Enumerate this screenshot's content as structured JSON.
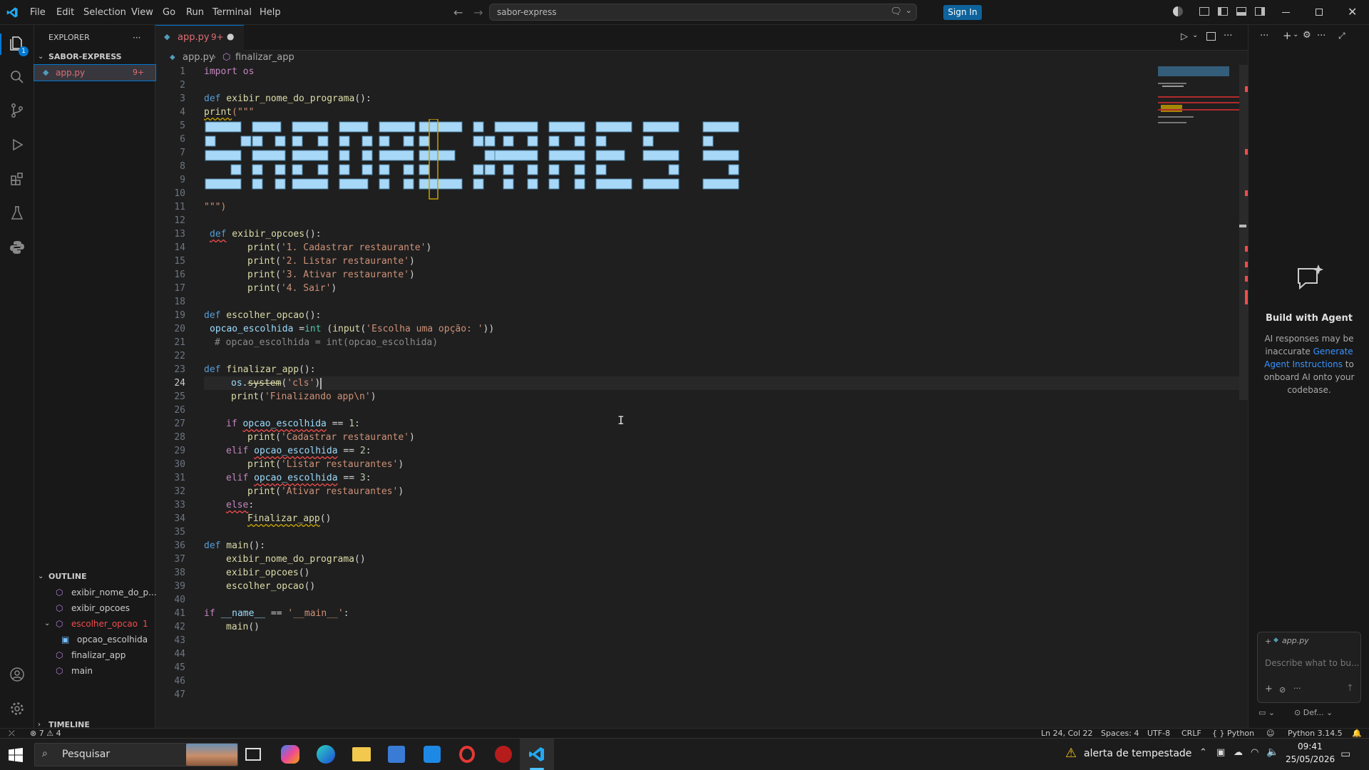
{
  "titlebar": {
    "menus": [
      "File",
      "Edit",
      "Selection",
      "View",
      "Go",
      "Run",
      "Terminal",
      "Help"
    ],
    "search_text": "sabor-express",
    "signin_label": "Sign In"
  },
  "sidebar": {
    "explorer_title": "EXPLORER",
    "project_name": "SABOR-EXPRESS",
    "file_name": "app.py",
    "file_badge": "9+",
    "outline_title": "OUTLINE",
    "outline_items": [
      "exibir_nome_do_p...",
      "exibir_opcoes",
      "escolher_opcao",
      "opcao_escolhida",
      "finalizar_app",
      "main"
    ],
    "outline_error_count": "1",
    "timeline_title": "TIMELINE"
  },
  "activity": {
    "explorer_badge": "1"
  },
  "editor": {
    "tab_label": "app.py",
    "tab_badge": "9+",
    "breadcrumb_file": "app.py",
    "breadcrumb_symbol": "finalizar_app",
    "lines": {
      "l1": "import os",
      "l3a": "def",
      "l3b": " exibir_nome_do_programa",
      "l3c": "():",
      "l4a": "print",
      "l4b": "(\"\"\"",
      "l11": "\"\"\")",
      "l13a": "def",
      "l13b": " exibir_opcoes",
      "l13c": "():",
      "l14": "'1. Cadastrar restaurante'",
      "l15": "'2. Listar restaurante'",
      "l16": "'3. Ativar restaurante'",
      "l17": "'4. Sair'",
      "l19a": "def",
      "l19b": " escolher_opcao",
      "l19c": "():",
      "l20a": "opcao_escolhida",
      "l20b": " =",
      "l20c": "int",
      "l20d": " (",
      "l20e": "input",
      "l20f": "(",
      "l20g": "'Escolha uma opção: '",
      "l20h": "))",
      "l21": "# opcao_escolhida = int(opcao_escolhida)",
      "l23a": "def",
      "l23b": " finalizar_app",
      "l23c": "():",
      "l24a": "os",
      "l24b": "system",
      "l24c": "'cls'",
      "l25": "'Finalizando app\\n'",
      "l27a": "if",
      "l27b": "opcao_escolhida",
      "l27c": " == ",
      "l27d": "1",
      "l27e": ":",
      "l28": "'Cadastrar restaurante'",
      "l29a": "elif",
      "l29b": "opcao_escolhida",
      "l29c": " == ",
      "l29d": "2",
      "l29e": ":",
      "l30": "'Listar restaurantes'",
      "l31a": "elif",
      "l31b": "opcao_escolhida",
      "l31c": " == ",
      "l31d": "3",
      "l31e": ":",
      "l32": "'Ativar restaurantes'",
      "l33a": "else",
      "l33b": ":",
      "l34": "Finalizar_app",
      "l36a": "def",
      "l36b": " main",
      "l36c": "():",
      "l37": "exibir_nome_do_programa",
      "l38": "exibir_opcoes",
      "l39": "escolher_opcao",
      "l41a": "if",
      "l41b": " __name__",
      "l41c": " == ",
      "l41d": "'__main__'",
      "l41e": ":",
      "l42": "main",
      "print": "print"
    }
  },
  "chat": {
    "title": "Build with Agent",
    "text1": "AI responses may be inaccurate",
    "link": "Generate Agent Instructions",
    "text2": "to onboard AI onto your codebase.",
    "context_file": "app.py",
    "placeholder": "Describe what to bu...",
    "mode_label": "Def..."
  },
  "statusbar": {
    "problems": "7",
    "warnings": "4",
    "position": "Ln 24, Col 22",
    "spaces": "Spaces: 4",
    "encoding": "UTF-8",
    "eol": "CRLF",
    "language": "Python",
    "interpreter": "Python 3.14.5"
  },
  "taskbar": {
    "search_placeholder": "Pesquisar",
    "weather": "alerta de tempestade",
    "time": "09:41",
    "date": "25/05/2026"
  }
}
